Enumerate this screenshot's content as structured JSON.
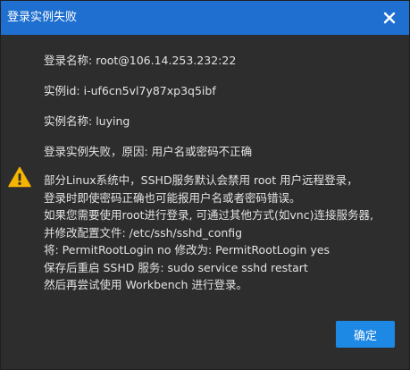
{
  "dialog": {
    "title": "登录实例失败",
    "close_icon": "close-icon",
    "accent_color": "#1e6fd0"
  },
  "info": {
    "login_name_label": "登录名称:",
    "login_name_value": "root@106.14.253.232:22",
    "instance_id_label": "实例id:",
    "instance_id_value": "i-uf6cn5vl7y87xp3q5ibf",
    "instance_name_label": "实例名称:",
    "instance_name_value": "luying",
    "failure_message": "登录实例失败，原因: 用户名或密码不正确"
  },
  "warning": {
    "icon": "warning-icon",
    "icon_color": "#f5b400",
    "lines": [
      "部分Linux系统中，SSHD服务默认会禁用 root 用户远程登录，",
      "登录时即使密码正确也可能报用户名或者密码错误。",
      "如果您需要使用root进行登录, 可通过其他方式(如vnc)连接服务器,",
      "并修改配置文件: /etc/ssh/sshd_config",
      "将: PermitRootLogin no 修改为: PermitRootLogin yes",
      "保存后重启 SSHD 服务: sudo service sshd restart",
      "然后再尝试使用 Workbench 进行登录。"
    ]
  },
  "footer": {
    "ok_label": "确定",
    "ok_color": "#1e88e5"
  }
}
